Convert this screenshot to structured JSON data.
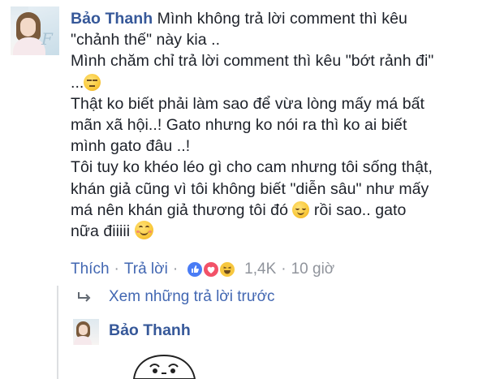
{
  "comment": {
    "author": "Bảo Thanh",
    "line1": "Mình không trả lời comment thì kêu",
    "line2": "\"chảnh thế\" này kia ..",
    "line3": "Mình chăm chỉ trả lời comment thì kêu \"bớt rảnh đi\"",
    "line4": "...",
    "line5": "Thật ko biết phải làm sao để vừa lòng mấy má bất",
    "line6": "mãn xã hội..! Gato nhưng ko nói ra thì ko ai biết",
    "line7": "mình gato đâu ..!",
    "line8": "Tôi tuy ko khéo léo gì cho cam nhưng tôi sống thật,",
    "line9": "khán giả cũng vì tôi không biết \"diễn sâu\" như mấy",
    "line10a": "má nên khán giả thương tôi đó",
    "line10b": "rồi sao.. gato",
    "line11": "nữa điiiii"
  },
  "actions": {
    "like": "Thích",
    "reply": "Trả lời",
    "separator": "·",
    "reaction_count": "1,4K",
    "time": "10 giờ"
  },
  "reactions": [
    "like-icon",
    "love-icon",
    "haha-icon"
  ],
  "colors": {
    "link": "#4267b2",
    "author": "#365899",
    "meta": "#90949c",
    "text": "#1d2129"
  },
  "replies": {
    "prev_label": "Xem những trả lời trước",
    "author": "Bảo Thanh"
  }
}
